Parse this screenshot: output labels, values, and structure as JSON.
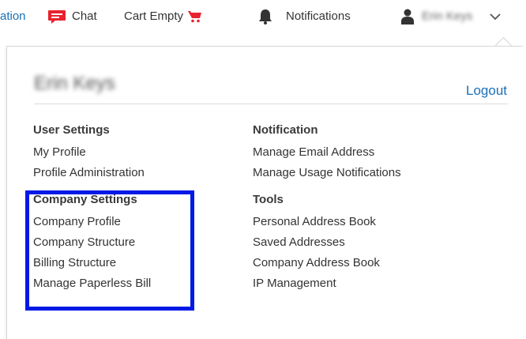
{
  "topbar": {
    "partial_link": "ation",
    "chat_label": "Chat",
    "cart_label": "Cart Empty",
    "notifications_label": "Notifications",
    "user_name": "Erin Keys"
  },
  "panel": {
    "user_name": "Erin Keys",
    "logout_label": "Logout",
    "user_settings": {
      "header": "User Settings",
      "items": [
        "My Profile",
        "Profile Administration"
      ]
    },
    "company_settings": {
      "header": "Company Settings",
      "items": [
        "Company Profile",
        "Company Structure",
        "Billing Structure",
        "Manage Paperless Bill"
      ]
    },
    "notification": {
      "header": "Notification",
      "items": [
        "Manage Email Address",
        "Manage Usage Notifications"
      ]
    },
    "tools": {
      "header": "Tools",
      "items": [
        "Personal Address Book",
        "Saved Addresses",
        "Company Address Book",
        "IP Management"
      ]
    }
  },
  "colors": {
    "link_blue": "#1a6fb7",
    "chat_red": "#e8222e",
    "highlight_blue": "#0019e6"
  },
  "icons": {
    "chat": "chat-bubble-icon",
    "cart": "cart-icon",
    "notifications": "bell-icon",
    "user": "user-icon",
    "dropdown": "chevron-down-icon"
  }
}
